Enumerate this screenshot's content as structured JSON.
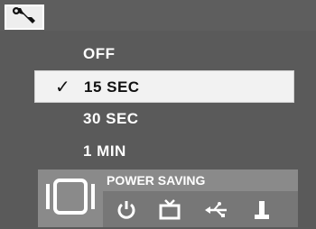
{
  "menu": {
    "items": [
      {
        "label": "OFF",
        "selected": false
      },
      {
        "label": "15 SEC",
        "selected": true
      },
      {
        "label": "30 SEC",
        "selected": false
      },
      {
        "label": "1 MIN",
        "selected": false
      }
    ],
    "check_glyph": "✓"
  },
  "bottom": {
    "section_label": "POWER SAVING",
    "icons": [
      "power-icon",
      "tv-icon",
      "usb-icon",
      "memory-card-icon"
    ],
    "left_icon": "display-mode-icon"
  },
  "header": {
    "settings_icon": "wrench-icon"
  },
  "colors": {
    "background": "#5a5a5a",
    "selected_row": "#f2f2f2",
    "label_bar": "#8a8a8a"
  }
}
